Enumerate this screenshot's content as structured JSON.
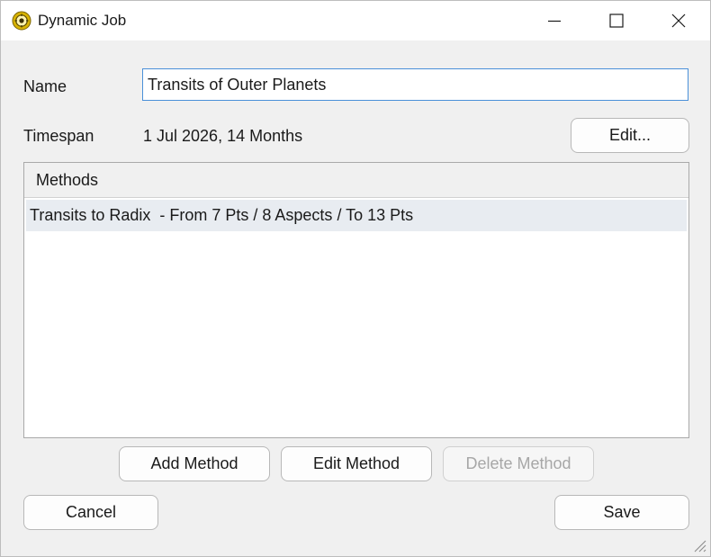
{
  "window": {
    "title": "Dynamic Job",
    "icon": "app-sun-icon",
    "controls": [
      "minimize-icon",
      "maximize-icon",
      "close-icon"
    ]
  },
  "form": {
    "name_label": "Name",
    "name_value": "Transits of Outer Planets",
    "timespan_label": "Timespan",
    "timespan_value": "1 Jul 2026, 14 Months",
    "edit_button": "Edit..."
  },
  "methods": {
    "header": "Methods",
    "rows": [
      "Transits to Radix  - From 7 Pts / 8 Aspects / To 13 Pts"
    ]
  },
  "actions": {
    "add_method": "Add Method",
    "edit_method": "Edit Method",
    "delete_method": "Delete Method",
    "cancel": "Cancel",
    "save": "Save"
  },
  "colors": {
    "accent_border": "#4a90d9",
    "selected_row": "#e8ecf1",
    "disabled_text": "#a7a7a7"
  }
}
